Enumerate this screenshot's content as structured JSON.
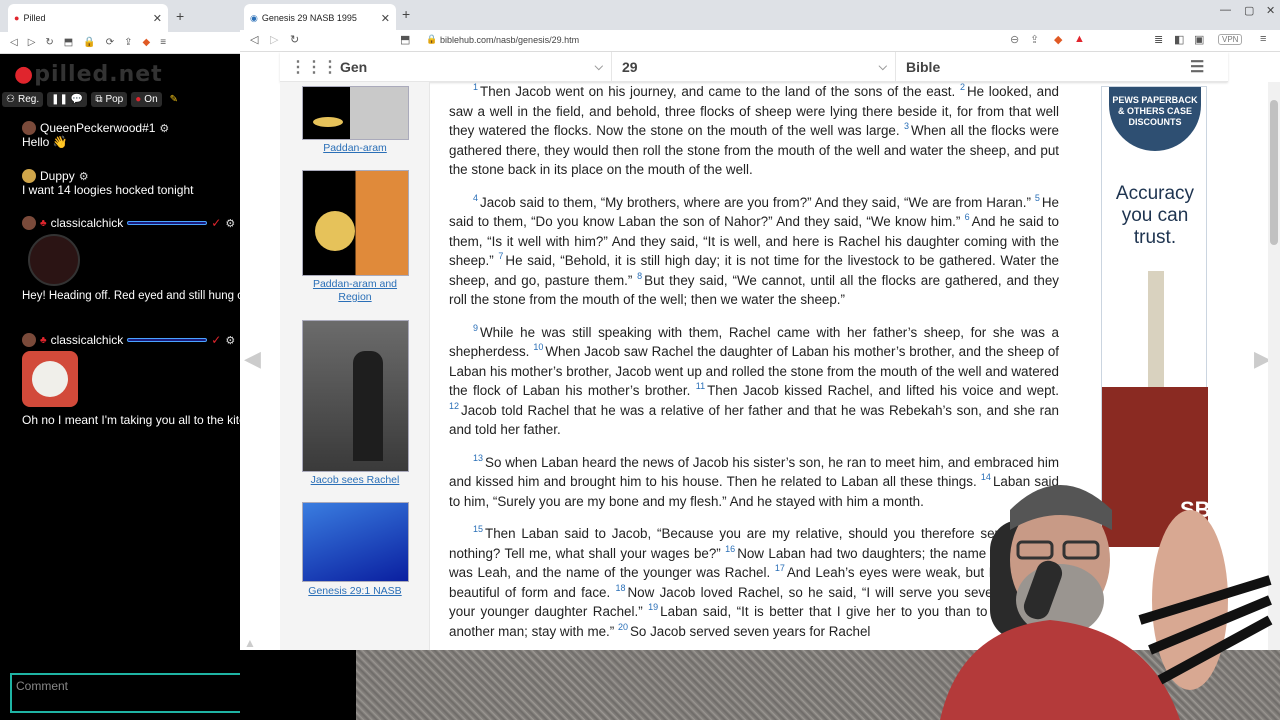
{
  "left_browser": {
    "tab_title": "Pilled",
    "logo": "pilled.net",
    "toolbar": {
      "reg": "Reg.",
      "pop": "Pop",
      "on": "On"
    },
    "messages": [
      {
        "user": "QueenPeckerwood#1",
        "text": "Hello 👋"
      },
      {
        "user": "Duppy",
        "text": "I want 14 loogies hocked tonight"
      },
      {
        "user": "classicalchick",
        "text": "Hey! Heading off. Red eyed and still hung over... let's go foraging..."
      },
      {
        "user": "classicalchick",
        "text": "Oh no I meant I'm taking you all to the kitchen"
      }
    ],
    "comment_placeholder": "Comment"
  },
  "right_browser": {
    "tab_title": "Genesis 29 NASB 1995",
    "url": "biblehub.com/nasb/genesis/29.htm",
    "vpn": "VPN"
  },
  "site": {
    "book": "Gen",
    "chapter": "29",
    "version": "Bible"
  },
  "maps": [
    {
      "caption": "Paddan-aram"
    },
    {
      "caption": "Paddan-aram and Region"
    },
    {
      "caption": "Jacob sees Rachel"
    },
    {
      "caption": "Genesis 29:1 NASB"
    }
  ],
  "verses": [
    {
      "n": "1",
      "t": "Then Jacob went on his journey, and came to the land of the sons of the east."
    },
    {
      "n": "2",
      "t": "He looked, and saw a well in the field, and behold, three flocks of sheep were lying there beside it, for from that well they watered the flocks. Now the stone on the mouth of the well was large."
    },
    {
      "n": "3",
      "t": "When all the flocks were gathered there, they would then roll the stone from the mouth of the well and water the sheep, and put the stone back in its place on the mouth of the well."
    },
    {
      "n": "4",
      "t": "Jacob said to them, “My brothers, where are you from?” And they said, “We are from Haran.”"
    },
    {
      "n": "5",
      "t": "He said to them, “Do you know Laban the son of Nahor?” And they said, “We know him.”"
    },
    {
      "n": "6",
      "t": "And he said to them, “Is it well with him?” And they said, “It is well, and here is Rachel his daughter coming with the sheep.”"
    },
    {
      "n": "7",
      "t": "He said, “Behold, it is still high day; it is not time for the livestock to be gathered. Water the sheep, and go, pasture them.”"
    },
    {
      "n": "8",
      "t": "But they said, “We cannot, until all the flocks are gathered, and they roll the stone from the mouth of the well; then we water the sheep.”"
    },
    {
      "n": "9",
      "t": "While he was still speaking with them, Rachel came with her father’s sheep, for she was a shepherdess."
    },
    {
      "n": "10",
      "t": "When Jacob saw Rachel the daughter of Laban his mother’s brother, and the sheep of Laban his mother’s brother, Jacob went up and rolled the stone from the mouth of the well and watered the flock of Laban his mother’s brother."
    },
    {
      "n": "11",
      "t": "Then Jacob kissed Rachel, and lifted his voice and wept."
    },
    {
      "n": "12",
      "t": "Jacob told Rachel that he was a relative of her father and that he was Rebekah’s son, and she ran and told her father."
    },
    {
      "n": "13",
      "t": "So when Laban heard the news of Jacob his sister’s son, he ran to meet him, and embraced him and kissed him and brought him to his house. Then he related to Laban all these things."
    },
    {
      "n": "14",
      "t": "Laban said to him, “Surely you are my bone and my flesh.” And he stayed with him a month."
    },
    {
      "n": "15",
      "t": "Then Laban said to Jacob, “Because you are my relative, should you therefore serve me for nothing? Tell me, what shall your wages be?”"
    },
    {
      "n": "16",
      "t": "Now Laban had two daughters; the name of the older was Leah, and the name of the younger was Rachel."
    },
    {
      "n": "17",
      "t": "And Leah’s eyes were weak, but Rachel was beautiful of form and face."
    },
    {
      "n": "18",
      "t": "Now Jacob loved Rachel, so he said, “I will serve you seven years for your younger daughter Rachel.”"
    },
    {
      "n": "19",
      "t": "Laban said, “It is better that I give her to you than to give her to another man; stay with me.”"
    },
    {
      "n": "20",
      "t": "So Jacob served seven years for Rachel"
    }
  ],
  "ad": {
    "medal": "PEWS PAPERBACK & OTHERS CASE DISCOUNTS",
    "slogan": "Accuracy you can trust.",
    "corner": "SB"
  }
}
